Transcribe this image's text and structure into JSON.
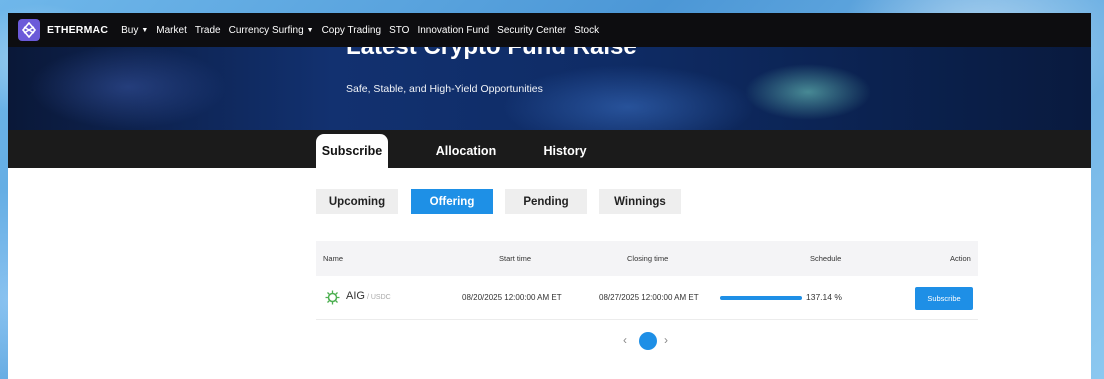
{
  "nav": {
    "brand": "ETHERMAC",
    "items": [
      {
        "label": "Buy",
        "dropdown": true
      },
      {
        "label": "Market",
        "dropdown": false
      },
      {
        "label": "Trade",
        "dropdown": false
      },
      {
        "label": "Currency Surfing",
        "dropdown": true
      },
      {
        "label": "Copy Trading",
        "dropdown": false
      },
      {
        "label": "STO",
        "dropdown": false
      },
      {
        "label": "Innovation Fund",
        "dropdown": false
      },
      {
        "label": "Security Center",
        "dropdown": false
      },
      {
        "label": "Stock",
        "dropdown": false
      }
    ]
  },
  "hero": {
    "title": "Latest Crypto Fund Raise",
    "subtitle": "Safe, Stable, and High-Yield Opportunities"
  },
  "tabs": [
    "Subscribe",
    "Allocation",
    "History"
  ],
  "active_tab": "Subscribe",
  "filters": [
    "Upcoming",
    "Offering",
    "Pending",
    "Winnings"
  ],
  "active_filter": "Offering",
  "table": {
    "headers": {
      "name": "Name",
      "start": "Start time",
      "closing": "Closing time",
      "schedule": "Schedule",
      "action": "Action"
    },
    "rows": [
      {
        "coin": "AIG",
        "quote": "/ USDC",
        "start": "08/20/2025 12:00:00 AM ET",
        "closing": "08/27/2025 12:00:00 AM ET",
        "progress": "137.14 %",
        "progress_fraction": 1.0,
        "action": "Subscribe"
      }
    ]
  },
  "pagination": {
    "current": "1",
    "prev": "‹",
    "next": "›"
  },
  "colors": {
    "accent": "#1e8fe6",
    "nav_bg": "#0d0d10",
    "tabbar_bg": "#1b1b1b"
  },
  "icons": {
    "logo": "ethermac-logo-icon",
    "coin": "aig-coin-icon"
  }
}
